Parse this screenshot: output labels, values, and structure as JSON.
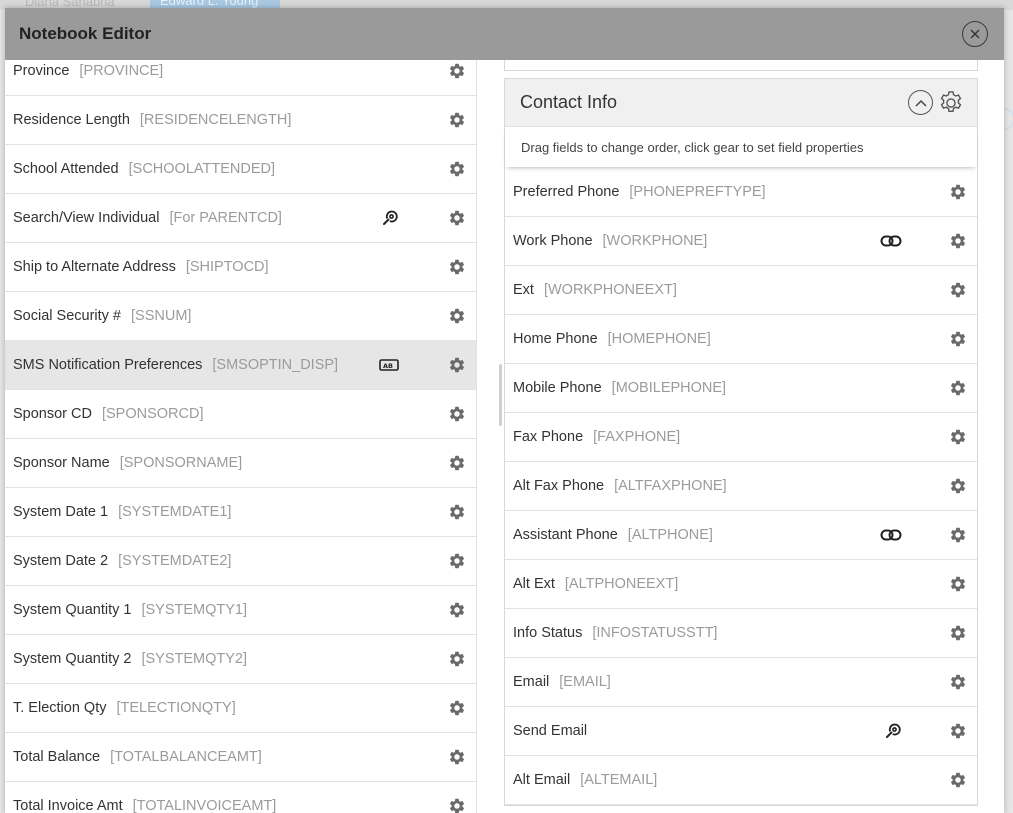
{
  "background": {
    "tab1": "Diana Sanabria",
    "tab2": "Edward L. Young"
  },
  "modal": {
    "title": "Notebook Editor"
  },
  "left_fields": [
    {
      "label": "Province",
      "code": "[PROVINCE]"
    },
    {
      "label": "Residence Length",
      "code": "[RESIDENCELENGTH]"
    },
    {
      "label": "School Attended",
      "code": "[SCHOOLATTENDED]"
    },
    {
      "label": "Search/View Individual",
      "code": "[For PARENTCD]",
      "icon": "lookup-icon"
    },
    {
      "label": "Ship to Alternate Address",
      "code": "[SHIPTOCD]"
    },
    {
      "label": "Social Security #",
      "code": "[SSNUM]"
    },
    {
      "label": "SMS Notification Preferences",
      "code": "[SMSOPTIN_DISP]",
      "icon": "text-field-icon",
      "selected": true
    },
    {
      "label": "Sponsor CD",
      "code": "[SPONSORCD]"
    },
    {
      "label": "Sponsor Name",
      "code": "[SPONSORNAME]"
    },
    {
      "label": "System Date 1",
      "code": "[SYSTEMDATE1]"
    },
    {
      "label": "System Date 2",
      "code": "[SYSTEMDATE2]"
    },
    {
      "label": "System Quantity 1",
      "code": "[SYSTEMQTY1]"
    },
    {
      "label": "System Quantity 2",
      "code": "[SYSTEMQTY2]"
    },
    {
      "label": "T. Election Qty",
      "code": "[TELECTIONQTY]"
    },
    {
      "label": "Total Balance",
      "code": "[TOTALBALANCEAMT]"
    },
    {
      "label": "Total Invoice Amt",
      "code": "[TOTALINVOICEAMT]"
    }
  ],
  "section": {
    "title": "Contact Info",
    "hint": "Drag fields to change order, click gear to set field properties",
    "fields": [
      {
        "label": "Preferred Phone",
        "code": "[PHONEPREFTYPE]"
      },
      {
        "label": "Work Phone",
        "code": "[WORKPHONE]",
        "icon": "link-icon"
      },
      {
        "label": "Ext",
        "code": "[WORKPHONEEXT]"
      },
      {
        "label": "Home Phone",
        "code": "[HOMEPHONE]"
      },
      {
        "label": "Mobile Phone",
        "code": "[MOBILEPHONE]"
      },
      {
        "label": "Fax Phone",
        "code": "[FAXPHONE]"
      },
      {
        "label": "Alt Fax Phone",
        "code": "[ALTFAXPHONE]"
      },
      {
        "label": "Assistant Phone",
        "code": "[ALTPHONE]",
        "icon": "link-icon"
      },
      {
        "label": "Alt Ext",
        "code": "[ALTPHONEEXT]"
      },
      {
        "label": "Info Status",
        "code": "[INFOSTATUSSTT]"
      },
      {
        "label": "Email",
        "code": "[EMAIL]"
      },
      {
        "label": "Send Email",
        "code": "",
        "icon": "lookup-icon"
      },
      {
        "label": "Alt Email",
        "code": "[ALTEMAIL]"
      }
    ]
  },
  "colors": {
    "header_bg": "#9a9a9a",
    "selected_row": "#e6e6e6",
    "code_text": "#9b9b9b",
    "section_header_bg": "#f0f0f0"
  }
}
